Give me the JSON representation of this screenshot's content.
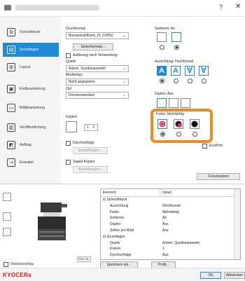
{
  "window": {
    "title": "",
    "help": "?",
    "close": "✕"
  },
  "nav": {
    "items": [
      {
        "label": "Schnelldruck",
        "icon": "quick-print"
      },
      {
        "label": "Grundlagen",
        "icon": "basic"
      },
      {
        "label": "Layout",
        "icon": "layout"
      },
      {
        "label": "Endbearbeitung",
        "icon": "finishing"
      },
      {
        "label": "Bildbearbeitung",
        "icon": "imaging"
      },
      {
        "label": "Veröffentlichung",
        "icon": "publishing"
      },
      {
        "label": "Auftrag",
        "icon": "job"
      },
      {
        "label": "Erweitert",
        "icon": "advanced"
      }
    ],
    "active": 1
  },
  "basic": {
    "druckformat_label": "Druckformat:",
    "druckformat_value": "Benutzerdefiniert_01 (100%)",
    "seitenformate": "Seitenformate...",
    "auflosung": "Auflösung nach Verwendung",
    "quelle_label": "Quelle",
    "quelle_value": "Autom. Quellenauswahl",
    "medientyp_label": "Medientyp:",
    "medientyp_value": "Nicht angegeben",
    "ziel_label": "Ziel",
    "ziel_value": "Druckerstandard",
    "kopien_label": "Kopien:",
    "kopien_value": "1",
    "durchschlage": "Durchschläge",
    "einstellungen1": "Einstellungen...",
    "stapel": "Stapel-Kopien",
    "einstellungen2": "Einstellungen..."
  },
  "right": {
    "sortieren": "Sortieren: An",
    "ausrichtung": "Ausrichtung: Hochformat",
    "duplex": "Duplex: Aus",
    "farbe": "Farbe: Mehrfarbig",
    "ecoprint": "EcoPrint",
    "zuruecksetzen": "Zurücksetzen"
  },
  "preview": {
    "model": "PCL XL",
    "druckvorschau": "Druckvorschau",
    "speichern": "Speichern als...",
    "profil": "Profil..."
  },
  "table": {
    "col1": "Element",
    "col2": "Detail",
    "rows": [
      {
        "e": "⊟ Schnelldruck",
        "d": ""
      },
      {
        "e": "Ausrichtung",
        "d": "Hochformat"
      },
      {
        "e": "Farbe",
        "d": "Mehrfarbig"
      },
      {
        "e": "Sortieren",
        "d": "An"
      },
      {
        "e": "Duplex",
        "d": "Aus"
      },
      {
        "e": "Seiten pro Blatt",
        "d": "Aus"
      },
      {
        "e": "⊟ Grundlagen",
        "d": ""
      },
      {
        "e": "Quelle",
        "d": "Autom. Quellenauswahl"
      },
      {
        "e": "Kopien",
        "d": "1"
      },
      {
        "e": "Durchschläge",
        "d": "Aus"
      }
    ]
  },
  "footer": {
    "brand": "KYOCERa",
    "ok": "OK",
    "cancel": "Abbrechen"
  },
  "colors": {
    "accent": "#1e8bd6",
    "highlight": "#f08a1e",
    "brand": "#dd1111"
  }
}
